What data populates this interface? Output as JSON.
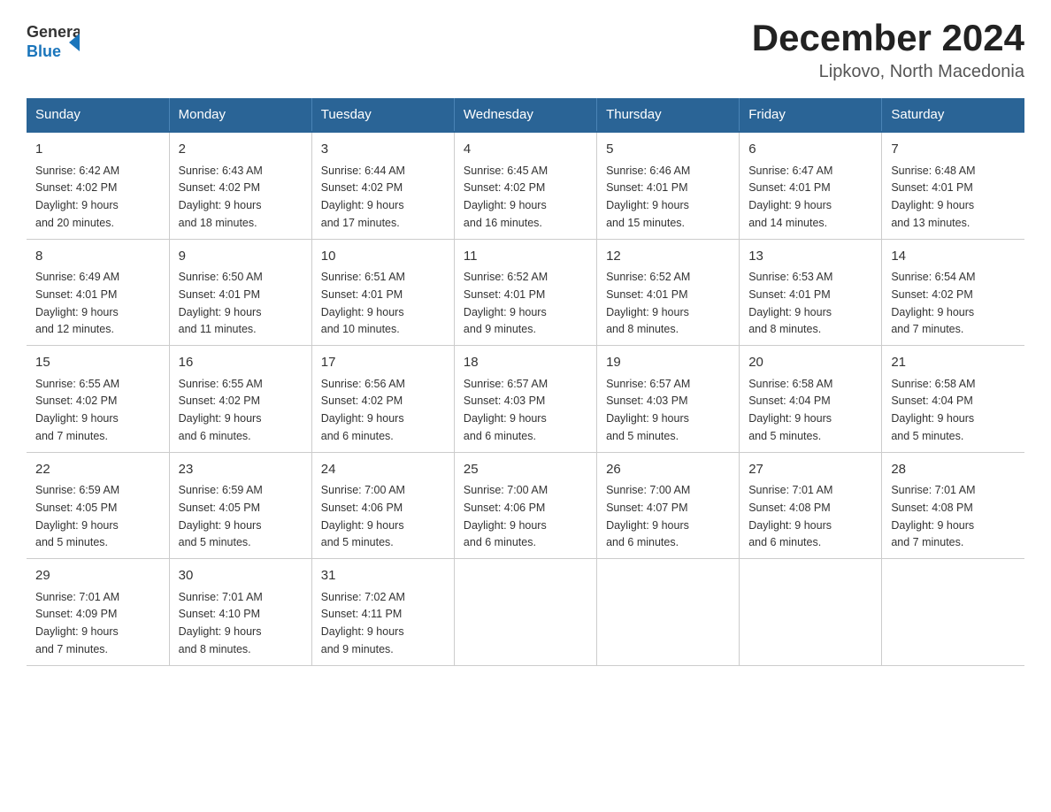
{
  "logo": {
    "text_general": "General",
    "text_blue": "Blue"
  },
  "title": {
    "month_year": "December 2024",
    "location": "Lipkovo, North Macedonia"
  },
  "days_of_week": [
    "Sunday",
    "Monday",
    "Tuesday",
    "Wednesday",
    "Thursday",
    "Friday",
    "Saturday"
  ],
  "weeks": [
    [
      {
        "day": "1",
        "sunrise": "6:42 AM",
        "sunset": "4:02 PM",
        "daylight": "9 hours and 20 minutes."
      },
      {
        "day": "2",
        "sunrise": "6:43 AM",
        "sunset": "4:02 PM",
        "daylight": "9 hours and 18 minutes."
      },
      {
        "day": "3",
        "sunrise": "6:44 AM",
        "sunset": "4:02 PM",
        "daylight": "9 hours and 17 minutes."
      },
      {
        "day": "4",
        "sunrise": "6:45 AM",
        "sunset": "4:02 PM",
        "daylight": "9 hours and 16 minutes."
      },
      {
        "day": "5",
        "sunrise": "6:46 AM",
        "sunset": "4:01 PM",
        "daylight": "9 hours and 15 minutes."
      },
      {
        "day": "6",
        "sunrise": "6:47 AM",
        "sunset": "4:01 PM",
        "daylight": "9 hours and 14 minutes."
      },
      {
        "day": "7",
        "sunrise": "6:48 AM",
        "sunset": "4:01 PM",
        "daylight": "9 hours and 13 minutes."
      }
    ],
    [
      {
        "day": "8",
        "sunrise": "6:49 AM",
        "sunset": "4:01 PM",
        "daylight": "9 hours and 12 minutes."
      },
      {
        "day": "9",
        "sunrise": "6:50 AM",
        "sunset": "4:01 PM",
        "daylight": "9 hours and 11 minutes."
      },
      {
        "day": "10",
        "sunrise": "6:51 AM",
        "sunset": "4:01 PM",
        "daylight": "9 hours and 10 minutes."
      },
      {
        "day": "11",
        "sunrise": "6:52 AM",
        "sunset": "4:01 PM",
        "daylight": "9 hours and 9 minutes."
      },
      {
        "day": "12",
        "sunrise": "6:52 AM",
        "sunset": "4:01 PM",
        "daylight": "9 hours and 8 minutes."
      },
      {
        "day": "13",
        "sunrise": "6:53 AM",
        "sunset": "4:01 PM",
        "daylight": "9 hours and 8 minutes."
      },
      {
        "day": "14",
        "sunrise": "6:54 AM",
        "sunset": "4:02 PM",
        "daylight": "9 hours and 7 minutes."
      }
    ],
    [
      {
        "day": "15",
        "sunrise": "6:55 AM",
        "sunset": "4:02 PM",
        "daylight": "9 hours and 7 minutes."
      },
      {
        "day": "16",
        "sunrise": "6:55 AM",
        "sunset": "4:02 PM",
        "daylight": "9 hours and 6 minutes."
      },
      {
        "day": "17",
        "sunrise": "6:56 AM",
        "sunset": "4:02 PM",
        "daylight": "9 hours and 6 minutes."
      },
      {
        "day": "18",
        "sunrise": "6:57 AM",
        "sunset": "4:03 PM",
        "daylight": "9 hours and 6 minutes."
      },
      {
        "day": "19",
        "sunrise": "6:57 AM",
        "sunset": "4:03 PM",
        "daylight": "9 hours and 5 minutes."
      },
      {
        "day": "20",
        "sunrise": "6:58 AM",
        "sunset": "4:04 PM",
        "daylight": "9 hours and 5 minutes."
      },
      {
        "day": "21",
        "sunrise": "6:58 AM",
        "sunset": "4:04 PM",
        "daylight": "9 hours and 5 minutes."
      }
    ],
    [
      {
        "day": "22",
        "sunrise": "6:59 AM",
        "sunset": "4:05 PM",
        "daylight": "9 hours and 5 minutes."
      },
      {
        "day": "23",
        "sunrise": "6:59 AM",
        "sunset": "4:05 PM",
        "daylight": "9 hours and 5 minutes."
      },
      {
        "day": "24",
        "sunrise": "7:00 AM",
        "sunset": "4:06 PM",
        "daylight": "9 hours and 5 minutes."
      },
      {
        "day": "25",
        "sunrise": "7:00 AM",
        "sunset": "4:06 PM",
        "daylight": "9 hours and 6 minutes."
      },
      {
        "day": "26",
        "sunrise": "7:00 AM",
        "sunset": "4:07 PM",
        "daylight": "9 hours and 6 minutes."
      },
      {
        "day": "27",
        "sunrise": "7:01 AM",
        "sunset": "4:08 PM",
        "daylight": "9 hours and 6 minutes."
      },
      {
        "day": "28",
        "sunrise": "7:01 AM",
        "sunset": "4:08 PM",
        "daylight": "9 hours and 7 minutes."
      }
    ],
    [
      {
        "day": "29",
        "sunrise": "7:01 AM",
        "sunset": "4:09 PM",
        "daylight": "9 hours and 7 minutes."
      },
      {
        "day": "30",
        "sunrise": "7:01 AM",
        "sunset": "4:10 PM",
        "daylight": "9 hours and 8 minutes."
      },
      {
        "day": "31",
        "sunrise": "7:02 AM",
        "sunset": "4:11 PM",
        "daylight": "9 hours and 9 minutes."
      },
      null,
      null,
      null,
      null
    ]
  ],
  "labels": {
    "sunrise": "Sunrise:",
    "sunset": "Sunset:",
    "daylight": "Daylight:"
  }
}
